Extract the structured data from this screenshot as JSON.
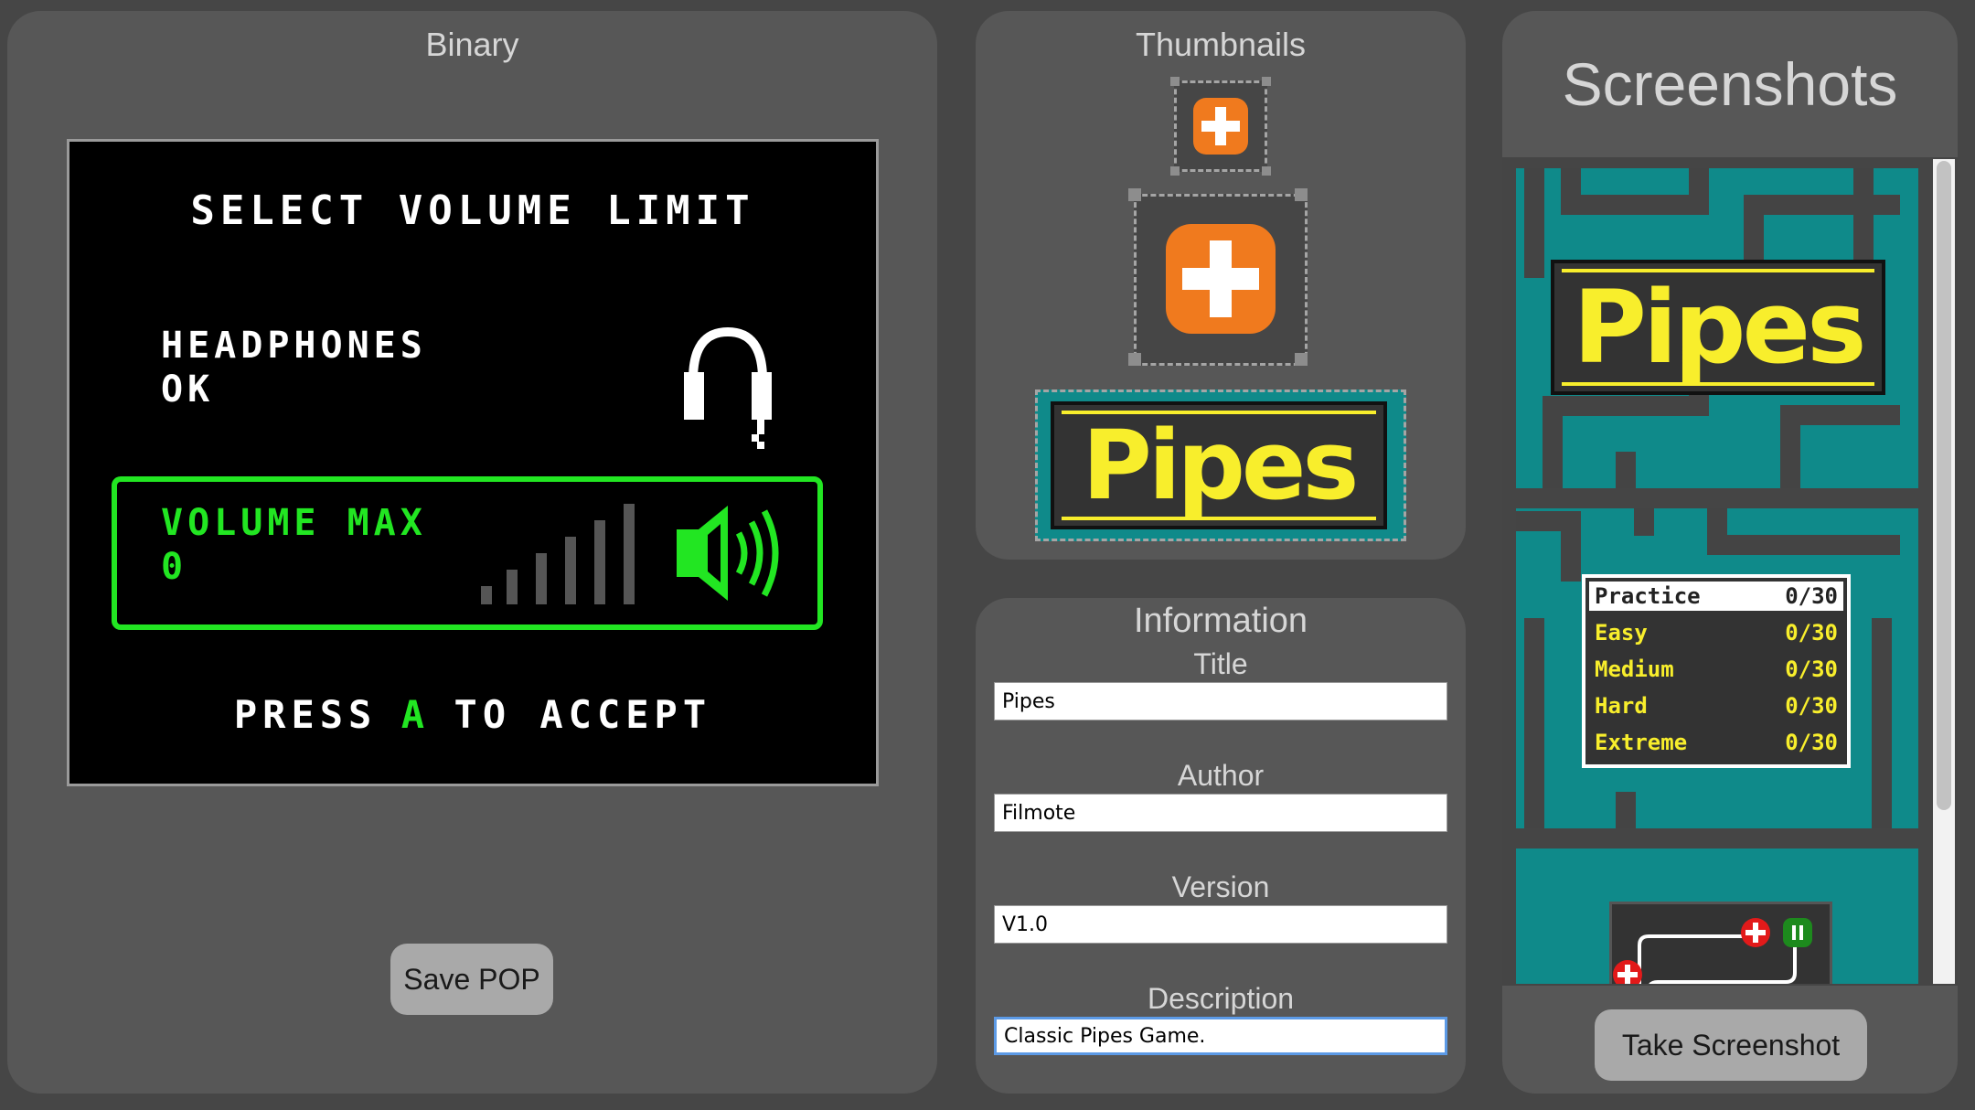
{
  "binary": {
    "title": "Binary",
    "screen": {
      "heading": "SELECT VOLUME LIMIT",
      "headphones_line1": "HEADPHONES",
      "headphones_line2": "OK",
      "volume_label": "VOLUME MAX",
      "volume_value": "0",
      "press": "PRESS",
      "a_key": "A",
      "to_accept": "TO ACCEPT"
    },
    "save_button": "Save POP"
  },
  "thumbnails": {
    "title": "Thumbnails",
    "logo_text": "Pipes"
  },
  "information": {
    "title": "Information",
    "fields": {
      "title": {
        "label": "Title",
        "value": "Pipes"
      },
      "author": {
        "label": "Author",
        "value": "Filmote"
      },
      "version": {
        "label": "Version",
        "value": "V1.0"
      },
      "description": {
        "label": "Description",
        "value": "Classic Pipes Game."
      }
    }
  },
  "screenshots": {
    "title": "Screenshots",
    "shot1_logo": "Pipes",
    "menu": [
      {
        "label": "Practice",
        "score": "0/30"
      },
      {
        "label": "Easy",
        "score": "0/30"
      },
      {
        "label": "Medium",
        "score": "0/30"
      },
      {
        "label": "Hard",
        "score": "0/30"
      },
      {
        "label": "Extreme",
        "score": "0/30"
      }
    ],
    "take_button": "Take Screenshot"
  },
  "colors": {
    "background": "#464646",
    "panel": "#575757",
    "screen_green": "#22e622",
    "pipes_yellow": "#f8ee2c",
    "teal": "#0f8a8a",
    "orange": "#f07a1e"
  }
}
